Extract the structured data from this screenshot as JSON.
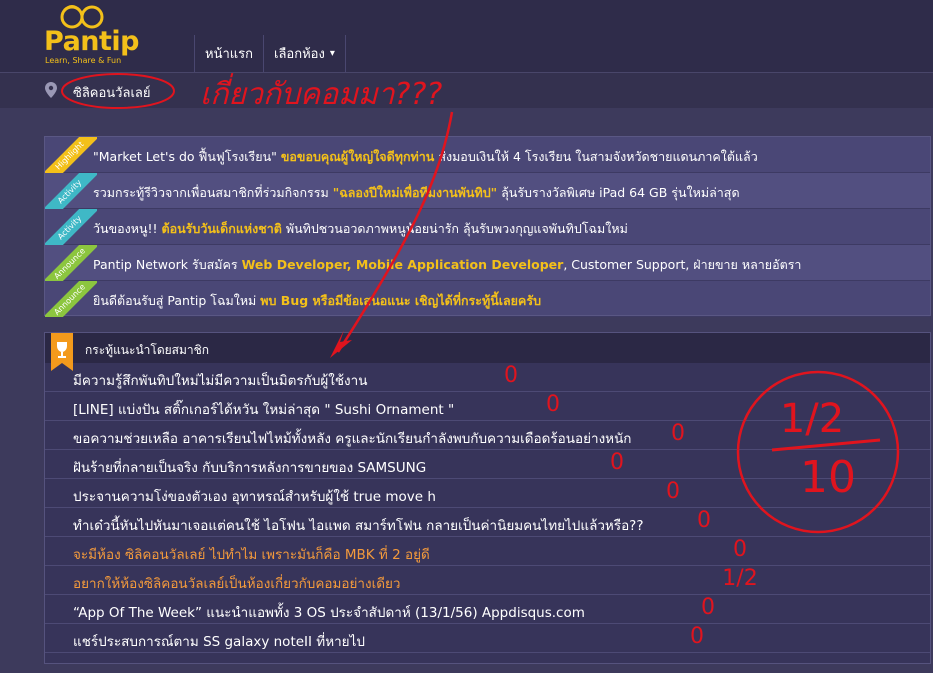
{
  "header": {
    "logo_word": "Pantip",
    "logo_tagline": "Learn, Share & Fun",
    "nav": [
      {
        "label": "หน้าแรก"
      },
      {
        "label": "เลือกห้อง",
        "caret": "▾"
      }
    ]
  },
  "breadcrumb": {
    "room": "ซิลิคอนวัลเลย์"
  },
  "announcements": [
    {
      "tag": "Highlight",
      "tag_color": "#f3c01a",
      "parts": [
        "\"Market Let's do ฟื้นฟูโรงเรียน\" ",
        "ขอขอบคุณผู้ใหญ่ใจดีทุกท่าน",
        " ส่งมอบเงินให้ 4 โรงเรียน ในสามจังหวัดชายแดนภาคใต้แล้ว"
      ]
    },
    {
      "tag": "Activity",
      "tag_color": "#3fb8c6",
      "parts": [
        "รวมกระทู้รีวิวจากเพื่อนสมาชิกที่ร่วมกิจกรรม ",
        "\"ฉลองปีใหม่เพื่อทีมงานพันทิป\"",
        " ลุ้นรับรางวัลพิเศษ iPad 64 GB รุ่นใหม่ล่าสุด"
      ]
    },
    {
      "tag": "Activity",
      "tag_color": "#3fb8c6",
      "parts": [
        "วันของหนู!! ",
        "ต้อนรับวันเด็กแห่งชาติ",
        " พันทิปชวนอวดภาพหนูน้อยน่ารัก ลุ้นรับพวงกุญแจพันทิปโฉมใหม่"
      ]
    },
    {
      "tag": "Announce",
      "tag_color": "#8cc63f",
      "parts": [
        "Pantip Network รับสมัคร ",
        "Web Developer, Mobile Application Developer",
        ", Customer Support, ฝ่ายขาย หลายอัตรา"
      ]
    },
    {
      "tag": "Announce",
      "tag_color": "#8cc63f",
      "parts": [
        "ยินดีต้อนรับสู่ Pantip โฉมใหม่ ",
        "พบ Bug หรือมีข้อเสนอแนะ เชิญได้ที่กระทู้นี้เลยครับ",
        ""
      ]
    }
  ],
  "recommended": {
    "title": "กระทู้แนะนำโดยสมาชิก",
    "items": [
      {
        "text": "มีความรู้สึกพันทิปใหม่ไม่มีความเป็นมิตรกับผู้ใช้งาน",
        "orange": false
      },
      {
        "text": "[LINE] แบ่งปัน สติ๊กเกอร์ได้หวัน ใหม่ล่าสุด \" Sushi Ornament \"",
        "orange": false
      },
      {
        "text": "ขอความช่วยเหลือ อาคารเรียนไฟไหม้ทั้งหลัง ครูและนักเรียนกำลังพบกับความเดือดร้อนอย่างหนัก",
        "orange": false
      },
      {
        "text": "ฝันร้ายที่กลายเป็นจริง กับบริการหลังการขายของ SAMSUNG",
        "orange": false
      },
      {
        "text": "ประจานความโง่ของตัวเอง อุทาหรณ์สำหรับผู้ใช้ true move h",
        "orange": false
      },
      {
        "text": "ทำเด๋วนี้หันไปหันมาเจอแต่คนใช้ ไอโฟน ไอแพด สมาร์ทโฟน กลายเป็นค่านิยมคนไทยไปแล้วหรือ??",
        "orange": false
      },
      {
        "text": "จะมีห้อง ซิลิคอนวัลเลย์ ไปทำไม เพราะมันก็คือ MBK ที่ 2 อยู่ดี",
        "orange": true
      },
      {
        "text": "อยากให้ห้องซิลิคอนวัลเลย์เป็นห้องเกี่ยวกับคอมอย่างเดียว",
        "orange": true
      },
      {
        "text": "“App Of The Week” แนะนำแอพทั้ง 3 OS ประจำสัปดาห์ (13/1/56) Appdisqus.com",
        "orange": false
      },
      {
        "text": "แชร์ประสบการณ์ตาม SS galaxy noteII ที่หายไป",
        "orange": false
      }
    ]
  },
  "annotation": {
    "handwriting": "เกี่ยวกับคอมมา???",
    "scores": [
      "0",
      "0",
      "0",
      "0",
      "0",
      "0",
      "0",
      "1/2",
      "0",
      "0"
    ],
    "total_num": "1/2",
    "total_den": "10",
    "ink_color": "#e0141e"
  },
  "icons": {
    "pin": "map-pin-icon",
    "trophy": "trophy-icon",
    "caret": "chevron-down-icon"
  }
}
